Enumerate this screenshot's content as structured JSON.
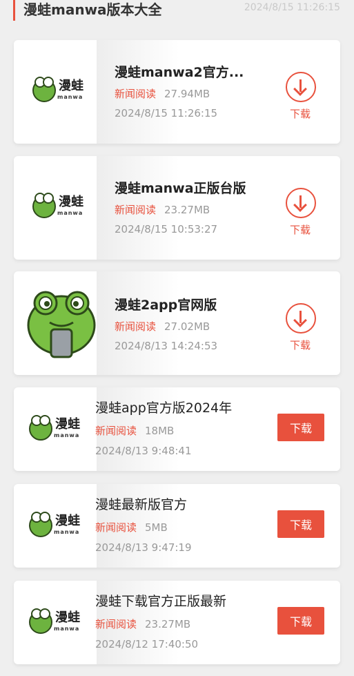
{
  "header": {
    "title": "漫蛙manwa版本大全",
    "time": "2024/8/15 11:26:15"
  },
  "logo": {
    "name": "漫蛙",
    "sub": "manwa"
  },
  "items": [
    {
      "name": "漫蛙manwa2官方...",
      "category": "新闻阅读",
      "size": "27.94MB",
      "date": "2024/8/15 11:26:15",
      "download": "下载"
    },
    {
      "name": "漫蛙manwa正版台版",
      "category": "新闻阅读",
      "size": "23.27MB",
      "date": "2024/8/15 10:53:27",
      "download": "下载"
    },
    {
      "name": "漫蛙2app官网版",
      "category": "新闻阅读",
      "size": "27.02MB",
      "date": "2024/8/13 14:24:53",
      "download": "下载"
    },
    {
      "name": "漫蛙app官方版2024年",
      "category": "新闻阅读",
      "size": "18MB",
      "date": "2024/8/13 9:48:41",
      "download": "下载"
    },
    {
      "name": "漫蛙最新版官方",
      "category": "新闻阅读",
      "size": "5MB",
      "date": "2024/8/13 9:47:19",
      "download": "下载"
    },
    {
      "name": "漫蛙下载官方正版最新",
      "category": "新闻阅读",
      "size": "23.27MB",
      "date": "2024/8/12 17:40:50",
      "download": "下载"
    }
  ],
  "colors": {
    "accent": "#e8513d",
    "muted": "#999999"
  }
}
